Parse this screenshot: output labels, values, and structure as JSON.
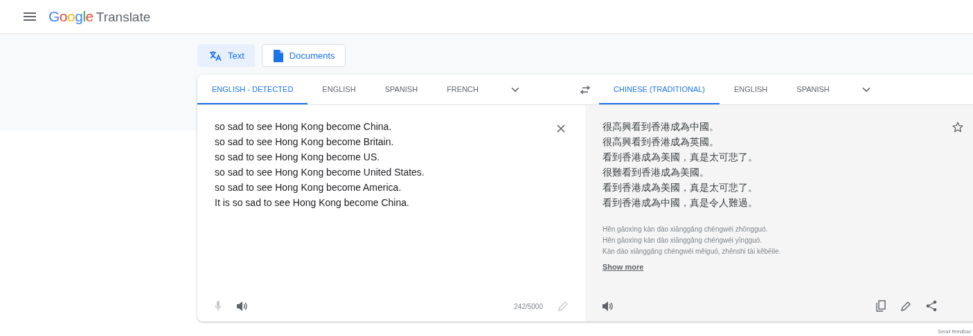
{
  "header": {
    "logo": "Google",
    "title": "Translate"
  },
  "modes": [
    {
      "label": "Text",
      "kind": "text",
      "selected": true
    },
    {
      "label": "Documents",
      "kind": "documents",
      "selected": false
    }
  ],
  "source_languages": [
    {
      "label": "ENGLISH - DETECTED",
      "selected": true
    },
    {
      "label": "ENGLISH",
      "selected": false
    },
    {
      "label": "SPANISH",
      "selected": false
    },
    {
      "label": "FRENCH",
      "selected": false
    }
  ],
  "target_languages": [
    {
      "label": "CHINESE (TRADITIONAL)",
      "selected": true
    },
    {
      "label": "ENGLISH",
      "selected": false
    },
    {
      "label": "SPANISH",
      "selected": false
    }
  ],
  "source_text": [
    "so sad to see Hong Kong become China.",
    "so sad to see Hong Kong become Britain.",
    "so sad to see Hong Kong become US.",
    "so sad to see Hong Kong become United States.",
    "so sad to see Hong Kong become America.",
    "It is so sad to see Hong Kong become China."
  ],
  "char_count": "242/5000",
  "translation": [
    "很高興看到香港成為中國。",
    "很高興看到香港成為英國。",
    "看到香港成為美國，真是太可悲了。",
    "很難看到香港成為美國。",
    "看到香港成為美國，真是太可悲了。",
    "看到香港成為中國，真是令人難過。"
  ],
  "romanization": [
    "Hěn gāoxìng kàn dào xiānggǎng chéngwéi zhōngguó.",
    "Hěn gāoxìng kàn dào xiānggǎng chéngwéi yīngguó.",
    "Kàn dào xiānggǎng chéngwéi měiguó, zhēnshi tài kěbēile."
  ],
  "show_more": "Show more",
  "send_feedback": "Send feedbac"
}
